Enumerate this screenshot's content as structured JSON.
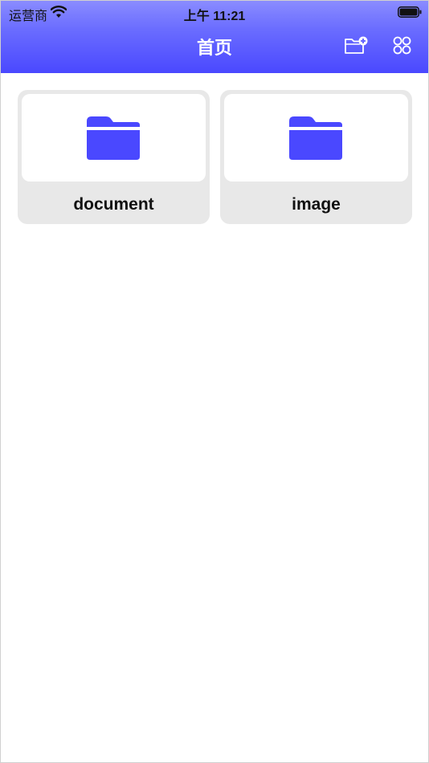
{
  "status_bar": {
    "carrier": "运营商",
    "time": "上午 11:21"
  },
  "nav": {
    "title": "首页",
    "new_folder_icon": "folder-add-icon",
    "grid_icon": "grid-icon"
  },
  "folders": [
    {
      "name": "document",
      "icon": "folder-icon"
    },
    {
      "name": "image",
      "icon": "folder-icon"
    }
  ],
  "colors": {
    "header_top": "#8a8cff",
    "header_bottom": "#4a48ff",
    "folder_icon": "#4a48ff",
    "card_bg": "#e8e8e8"
  }
}
